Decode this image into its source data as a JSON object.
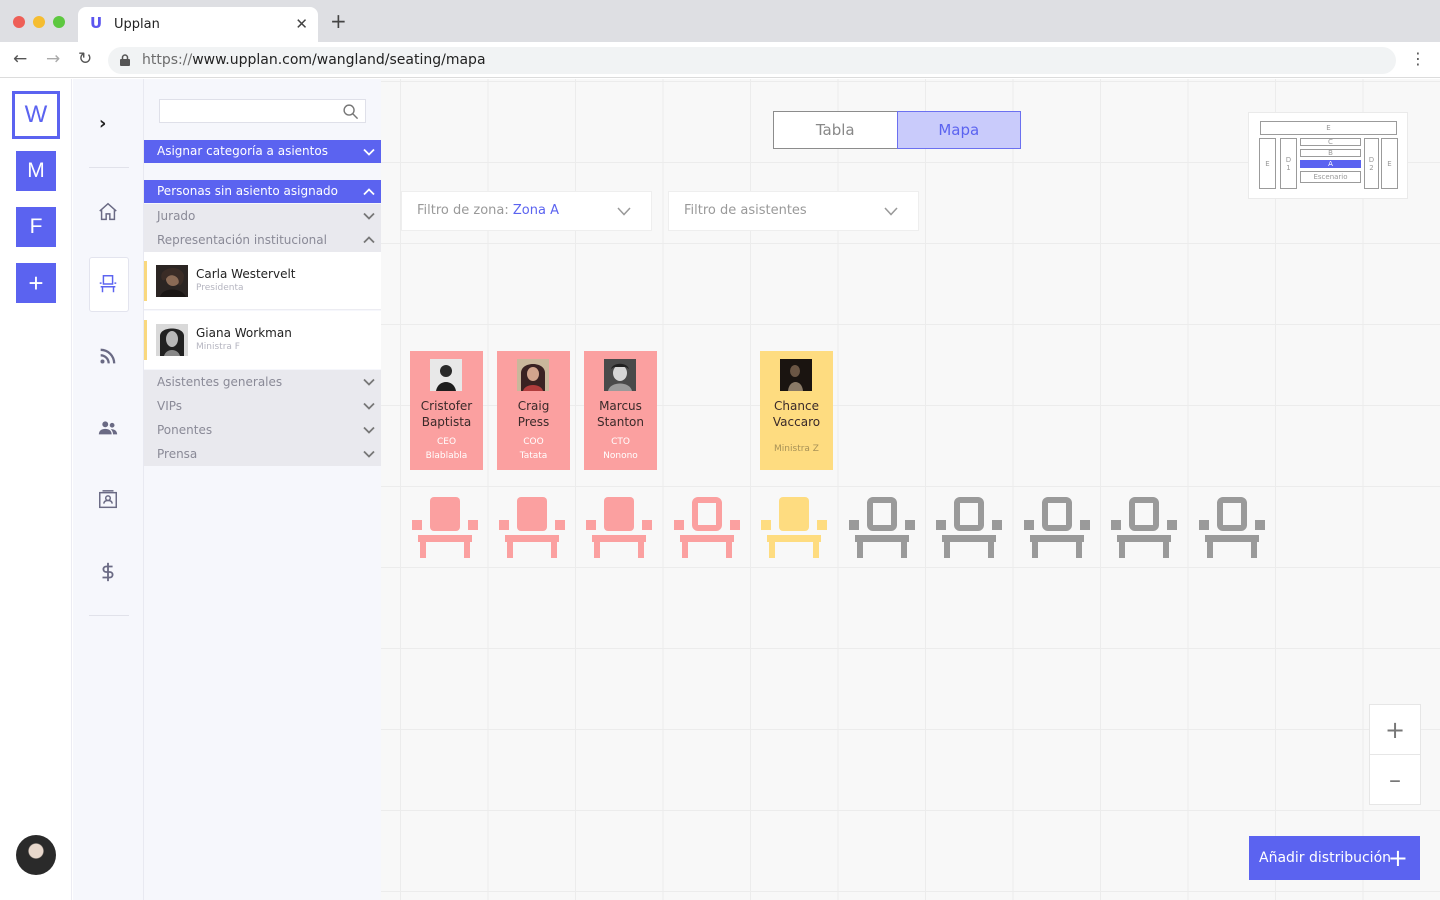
{
  "browser": {
    "tab_title": "Upplan",
    "url_prefix": "https://",
    "url_main": "www.upplan.com/wangland/seating/mapa"
  },
  "workspaces": [
    "W",
    "M",
    "F",
    "+"
  ],
  "sidebar": {
    "assign_category_label": "Asignar categoría a asientos",
    "unassigned_label": "Personas sin asiento asignado",
    "groups_top": [
      "Jurado",
      "Representación institucional"
    ],
    "people": [
      {
        "name": "Carla Westervelt",
        "role": "Presidenta"
      },
      {
        "name": "Giana Workman",
        "role": "Ministra F"
      }
    ],
    "groups_bottom": [
      "Asistentes generales",
      "VIPs",
      "Ponentes",
      "Prensa"
    ]
  },
  "view_toggle": {
    "tabla": "Tabla",
    "mapa": "Mapa",
    "active": "Mapa"
  },
  "filters": {
    "zone_label": "Filtro de zona:",
    "zone_value": "Zona A",
    "attendees_placeholder": "Filtro de asistentes"
  },
  "minimap": {
    "e_top": "E",
    "c": "C",
    "b": "B",
    "a": "A",
    "stage": "Escenario",
    "e_left": "E",
    "d1_d": "D",
    "d1_n": "1",
    "d2_d": "D",
    "d2_n": "2",
    "e_right": "E"
  },
  "seated_cards": [
    {
      "first": "Cristofer",
      "last": "Baptista",
      "role": "CEO",
      "org": "Blablabla",
      "color": "#fba0a0"
    },
    {
      "first": "Craig",
      "last": "Press",
      "role": "COO",
      "org": "Tatata",
      "color": "#fba0a0"
    },
    {
      "first": "Marcus",
      "last": "Stanton",
      "role": "CTO",
      "org": "Nonono",
      "color": "#fba0a0"
    },
    {
      "first": "Chance",
      "last": "Vaccaro",
      "role": "Ministra Z",
      "org": "",
      "color": "#fedc80"
    }
  ],
  "seats": [
    {
      "status": "occupied",
      "color": "#fba0a0"
    },
    {
      "status": "occupied",
      "color": "#fba0a0"
    },
    {
      "status": "occupied",
      "color": "#fba0a0"
    },
    {
      "status": "reserved",
      "color": "#fba0a0"
    },
    {
      "status": "occupied",
      "color": "#fedc80"
    },
    {
      "status": "empty",
      "color": "#9a9a9a"
    },
    {
      "status": "empty",
      "color": "#9a9a9a"
    },
    {
      "status": "empty",
      "color": "#9a9a9a"
    },
    {
      "status": "empty",
      "color": "#9a9a9a"
    },
    {
      "status": "empty",
      "color": "#9a9a9a"
    }
  ],
  "zoom": {
    "in": "+",
    "out": "–"
  },
  "add_distribution_label": "Añadir distribución",
  "icons": [
    "home-icon",
    "seat-icon",
    "rss-icon",
    "people-icon",
    "contact-card-icon",
    "dollar-icon",
    "search-icon"
  ],
  "colors": {
    "accent": "#5b63f0",
    "vip": "#fba0a0",
    "institutional": "#fedc80",
    "empty": "#9a9a9a"
  }
}
